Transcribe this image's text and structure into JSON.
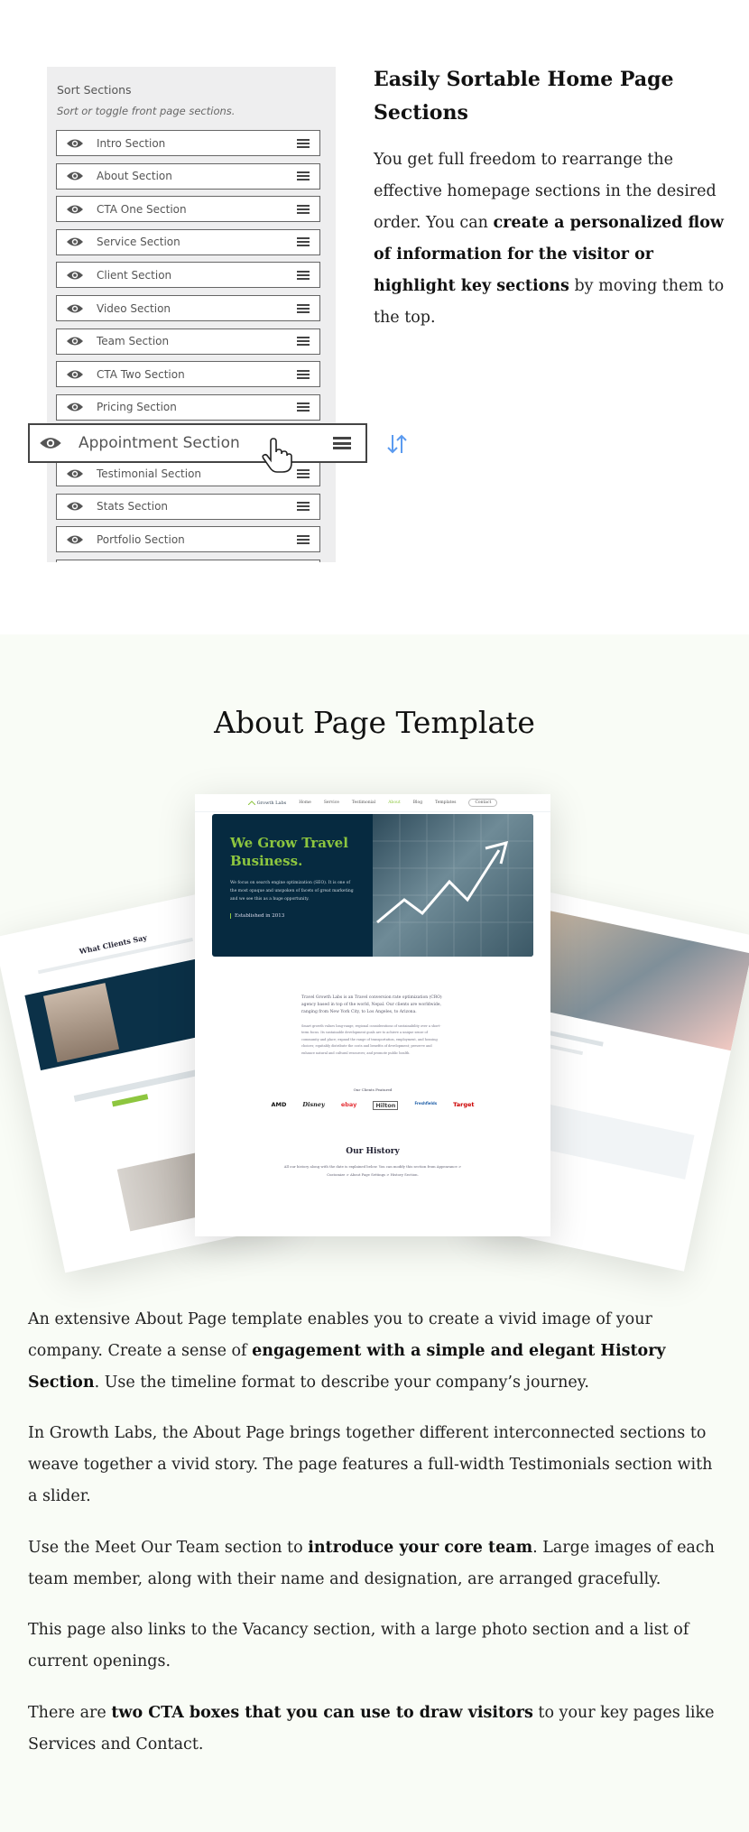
{
  "sort_panel": {
    "title": "Sort Sections",
    "subtitle": "Sort or toggle front page sections.",
    "items": [
      {
        "label": "Intro Section"
      },
      {
        "label": "About Section"
      },
      {
        "label": "CTA One Section"
      },
      {
        "label": "Service Section"
      },
      {
        "label": "Client Section"
      },
      {
        "label": "Video Section"
      },
      {
        "label": "Team Section"
      },
      {
        "label": "CTA Two Section"
      },
      {
        "label": "Pricing Section"
      },
      {
        "label": "Testimonial Section"
      },
      {
        "label": "Stats Section"
      },
      {
        "label": "Portfolio Section"
      }
    ],
    "dragging_item": "Appointment Section",
    "icons": {
      "visibility": "eye-icon",
      "handle": "hamburger-icon",
      "cursor": "hand-pointer-icon",
      "sort": "sort-arrows-icon"
    },
    "accent_color": "#5b9bf0"
  },
  "feature": {
    "heading": "Easily Sortable Home Page Sections",
    "p_a": "You get full freedom to rearrange the effective homepage sections in the desired order. You can ",
    "p_b": "create a personalized flow of information for the visitor or highlight key sections",
    "p_c": " by moving them to the top."
  },
  "about": {
    "title": "About Page Template",
    "mockup": {
      "nav": {
        "logo": "Growth Labs",
        "items": [
          "Home",
          "Service",
          "Testimonial",
          "About",
          "Blog",
          "Templates"
        ],
        "active": "About",
        "contact": "Contact"
      },
      "hero_title": "We Grow Travel Business.",
      "hero_text": "We focus on search engine optimization (SEO). It is one of the most opaque and unspoken of facets of great marketing and we see this as a huge opportunity.",
      "established": "Established in 2013",
      "intro": "Travel Growth Labs is an Travel conversion rate optimization (CRO) agency based in top of the world, Nepal. Our clients are worldwide, ranging from New York City, to Los Angeles, to Arizona.",
      "intro_small": "Smart growth values long-range, regional considerations of sustainability over a short-term focus. Its sustainable development goals are to achieve a unique sense of community and place; expand the range of transportation, employment, and housing choices; equitably distribute the costs and benefits of development; preserve and enhance natural and cultural resources; and promote public health.",
      "clients_label": "Our Clients Featured",
      "clients": [
        {
          "name": "AMD",
          "color": "#111111"
        },
        {
          "name": "Disney",
          "color": "#222222"
        },
        {
          "name": "ebay",
          "color": "#e53238"
        },
        {
          "name": "Hilton",
          "color": "#444444"
        },
        {
          "name": "Freshfields",
          "color": "#1f5fa8"
        },
        {
          "name": "Target",
          "color": "#cc0000"
        }
      ],
      "history_title": "Our History",
      "history_text": "All our history along with the date is explained below. You can modify this section from Appearance > Customize > About Page Settings > History Section.",
      "left_card_title": "What Clients Say",
      "accent_color": "#8dc63f",
      "hero_color": "#062a40"
    },
    "paragraphs": [
      {
        "a": "An extensive About Page template enables you to create a vivid image of your company. Create a sense of ",
        "b": "engagement with a simple and elegant History Section",
        "c": ". Use the timeline format to describe your company’s journey."
      },
      {
        "a": "In Growth Labs, the About Page brings together different interconnected sections to weave together a vivid story. The page features a full-width Testimonials section with a slider.",
        "b": "",
        "c": ""
      },
      {
        "a": "Use the Meet Our Team section to ",
        "b": "introduce your core team",
        "c": ". Large images of each team member, along with their name and designation, are arranged gracefully."
      },
      {
        "a": "This page also links to the Vacancy section, with a large photo section and a list of current openings.",
        "b": "",
        "c": ""
      },
      {
        "a": "There are ",
        "b": "two CTA boxes that you can use to draw visitors",
        "c": " to your key pages like Services and Contact."
      }
    ]
  }
}
